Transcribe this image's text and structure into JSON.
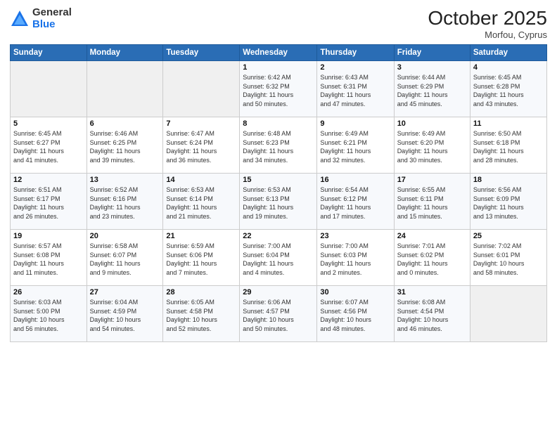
{
  "header": {
    "logo_general": "General",
    "logo_blue": "Blue",
    "month": "October 2025",
    "location": "Morfou, Cyprus"
  },
  "weekdays": [
    "Sunday",
    "Monday",
    "Tuesday",
    "Wednesday",
    "Thursday",
    "Friday",
    "Saturday"
  ],
  "weeks": [
    [
      {
        "day": "",
        "info": ""
      },
      {
        "day": "",
        "info": ""
      },
      {
        "day": "",
        "info": ""
      },
      {
        "day": "1",
        "info": "Sunrise: 6:42 AM\nSunset: 6:32 PM\nDaylight: 11 hours\nand 50 minutes."
      },
      {
        "day": "2",
        "info": "Sunrise: 6:43 AM\nSunset: 6:31 PM\nDaylight: 11 hours\nand 47 minutes."
      },
      {
        "day": "3",
        "info": "Sunrise: 6:44 AM\nSunset: 6:29 PM\nDaylight: 11 hours\nand 45 minutes."
      },
      {
        "day": "4",
        "info": "Sunrise: 6:45 AM\nSunset: 6:28 PM\nDaylight: 11 hours\nand 43 minutes."
      }
    ],
    [
      {
        "day": "5",
        "info": "Sunrise: 6:45 AM\nSunset: 6:27 PM\nDaylight: 11 hours\nand 41 minutes."
      },
      {
        "day": "6",
        "info": "Sunrise: 6:46 AM\nSunset: 6:25 PM\nDaylight: 11 hours\nand 39 minutes."
      },
      {
        "day": "7",
        "info": "Sunrise: 6:47 AM\nSunset: 6:24 PM\nDaylight: 11 hours\nand 36 minutes."
      },
      {
        "day": "8",
        "info": "Sunrise: 6:48 AM\nSunset: 6:23 PM\nDaylight: 11 hours\nand 34 minutes."
      },
      {
        "day": "9",
        "info": "Sunrise: 6:49 AM\nSunset: 6:21 PM\nDaylight: 11 hours\nand 32 minutes."
      },
      {
        "day": "10",
        "info": "Sunrise: 6:49 AM\nSunset: 6:20 PM\nDaylight: 11 hours\nand 30 minutes."
      },
      {
        "day": "11",
        "info": "Sunrise: 6:50 AM\nSunset: 6:18 PM\nDaylight: 11 hours\nand 28 minutes."
      }
    ],
    [
      {
        "day": "12",
        "info": "Sunrise: 6:51 AM\nSunset: 6:17 PM\nDaylight: 11 hours\nand 26 minutes."
      },
      {
        "day": "13",
        "info": "Sunrise: 6:52 AM\nSunset: 6:16 PM\nDaylight: 11 hours\nand 23 minutes."
      },
      {
        "day": "14",
        "info": "Sunrise: 6:53 AM\nSunset: 6:14 PM\nDaylight: 11 hours\nand 21 minutes."
      },
      {
        "day": "15",
        "info": "Sunrise: 6:53 AM\nSunset: 6:13 PM\nDaylight: 11 hours\nand 19 minutes."
      },
      {
        "day": "16",
        "info": "Sunrise: 6:54 AM\nSunset: 6:12 PM\nDaylight: 11 hours\nand 17 minutes."
      },
      {
        "day": "17",
        "info": "Sunrise: 6:55 AM\nSunset: 6:11 PM\nDaylight: 11 hours\nand 15 minutes."
      },
      {
        "day": "18",
        "info": "Sunrise: 6:56 AM\nSunset: 6:09 PM\nDaylight: 11 hours\nand 13 minutes."
      }
    ],
    [
      {
        "day": "19",
        "info": "Sunrise: 6:57 AM\nSunset: 6:08 PM\nDaylight: 11 hours\nand 11 minutes."
      },
      {
        "day": "20",
        "info": "Sunrise: 6:58 AM\nSunset: 6:07 PM\nDaylight: 11 hours\nand 9 minutes."
      },
      {
        "day": "21",
        "info": "Sunrise: 6:59 AM\nSunset: 6:06 PM\nDaylight: 11 hours\nand 7 minutes."
      },
      {
        "day": "22",
        "info": "Sunrise: 7:00 AM\nSunset: 6:04 PM\nDaylight: 11 hours\nand 4 minutes."
      },
      {
        "day": "23",
        "info": "Sunrise: 7:00 AM\nSunset: 6:03 PM\nDaylight: 11 hours\nand 2 minutes."
      },
      {
        "day": "24",
        "info": "Sunrise: 7:01 AM\nSunset: 6:02 PM\nDaylight: 11 hours\nand 0 minutes."
      },
      {
        "day": "25",
        "info": "Sunrise: 7:02 AM\nSunset: 6:01 PM\nDaylight: 10 hours\nand 58 minutes."
      }
    ],
    [
      {
        "day": "26",
        "info": "Sunrise: 6:03 AM\nSunset: 5:00 PM\nDaylight: 10 hours\nand 56 minutes."
      },
      {
        "day": "27",
        "info": "Sunrise: 6:04 AM\nSunset: 4:59 PM\nDaylight: 10 hours\nand 54 minutes."
      },
      {
        "day": "28",
        "info": "Sunrise: 6:05 AM\nSunset: 4:58 PM\nDaylight: 10 hours\nand 52 minutes."
      },
      {
        "day": "29",
        "info": "Sunrise: 6:06 AM\nSunset: 4:57 PM\nDaylight: 10 hours\nand 50 minutes."
      },
      {
        "day": "30",
        "info": "Sunrise: 6:07 AM\nSunset: 4:56 PM\nDaylight: 10 hours\nand 48 minutes."
      },
      {
        "day": "31",
        "info": "Sunrise: 6:08 AM\nSunset: 4:54 PM\nDaylight: 10 hours\nand 46 minutes."
      },
      {
        "day": "",
        "info": ""
      }
    ]
  ]
}
